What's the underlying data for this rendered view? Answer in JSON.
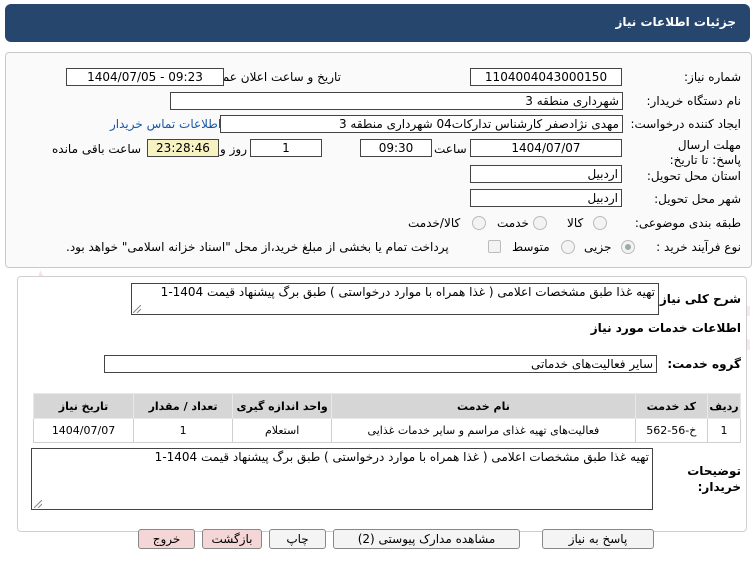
{
  "title": "جزئیات اطلاعات نیاز",
  "fields": {
    "need_number_label": "شماره نیاز:",
    "need_number": "1104004043000150",
    "announce_label": "تاریخ و ساعت اعلان عمومی:",
    "announce_value": "1404/07/05 - 09:23",
    "buyer_org_label": "نام دستگاه خریدار:",
    "buyer_org": "شهرداری منطقه 3",
    "creator_label": "ایجاد کننده درخواست:",
    "creator": "مهدی نژادصفر کارشناس تدارکات04 شهرداری منطقه 3",
    "contact_link": "اطلاعات تماس خریدار",
    "deadline_label": "مهلت ارسال پاسخ: تا تاریخ:",
    "deadline_date": "1404/07/07",
    "time_label": "ساعت",
    "deadline_time": "09:30",
    "days_value": "1",
    "days_label": "روز و",
    "remaining_value": "23:28:46",
    "remaining_label": "ساعت باقی مانده",
    "province_label": "استان محل تحویل:",
    "province": "اردبیل",
    "city_label": "شهر محل تحویل:",
    "city": "اردبیل",
    "category_label": "طبقه بندی موضوعی:",
    "category_options": [
      "کالا",
      "خدمت",
      "کالا/خدمت"
    ],
    "process_label": "نوع فرآیند خرید :",
    "process_options": [
      "جزیی",
      "متوسط"
    ],
    "payment_note": "پرداخت تمام یا بخشی از مبلغ خرید،از محل \"اسناد خزانه اسلامی\" خواهد بود."
  },
  "description": {
    "label": "شرح کلی نیاز:",
    "text": "تهیه غذا طبق مشخصات اعلامی ( غذا همراه با موارد درخواستی ) طبق برگ پیشنهاد قیمت 1404-1"
  },
  "services": {
    "heading": "اطلاعات خدمات مورد نیاز",
    "group_label": "گروه خدمت:",
    "group_value": "سایر فعالیت‌های خدماتی",
    "columns": [
      "ردیف",
      "کد خدمت",
      "نام خدمت",
      "واحد اندازه گیری",
      "تعداد / مقدار",
      "تاریخ نیاز"
    ],
    "rows": [
      [
        "1",
        "خ-56-562",
        "فعالیت‌های تهیه غذای مراسم و سایر خدمات غذایی",
        "استعلام",
        "1",
        "1404/07/07"
      ]
    ]
  },
  "buyer_notes": {
    "label": "توضیحات خریدار:",
    "text": "تهیه غذا طبق مشخصات اعلامی ( غذا همراه با موارد درخواستی ) طبق برگ پیشنهاد قیمت 1404-1"
  },
  "buttons": {
    "reply": "پاسخ به نیاز",
    "attachments": "مشاهده مدارک پیوستی (2)",
    "print": "چاپ",
    "back": "بازگشت",
    "exit": "خروج"
  },
  "watermark": "AriaTender.net"
}
